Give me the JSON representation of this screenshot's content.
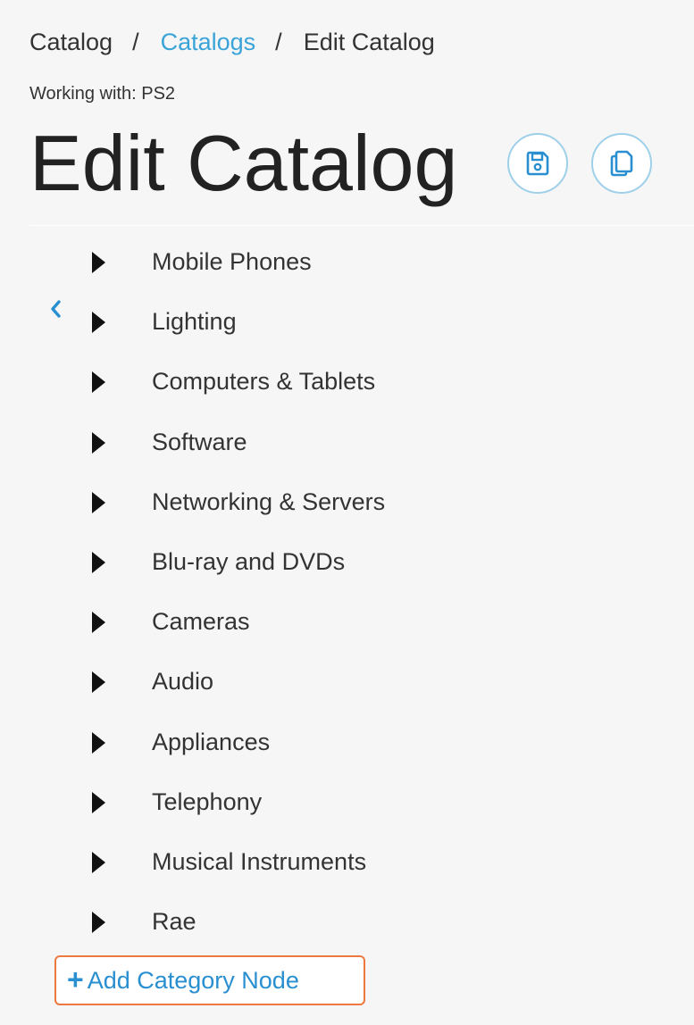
{
  "breadcrumb": {
    "items": [
      "Catalog",
      "Catalogs",
      "Edit Catalog"
    ],
    "separator": "/"
  },
  "working_with": "Working with: PS2",
  "page_title": "Edit Catalog",
  "actions": {
    "save_icon": "floppy-disk-icon",
    "copy_icon": "copy-icon"
  },
  "categories": [
    "Mobile Phones",
    "Lighting",
    "Computers & Tablets",
    "Software",
    "Networking & Servers",
    "Blu-ray and DVDs",
    "Cameras",
    "Audio",
    "Appliances",
    "Telephony",
    "Musical Instruments",
    "Rae"
  ],
  "add_category_label": "Add Category Node",
  "colors": {
    "link": "#3aa3d8",
    "accent_blue": "#2a8fd0",
    "focus_outline": "#ee7940",
    "background": "#f6f6f6"
  }
}
